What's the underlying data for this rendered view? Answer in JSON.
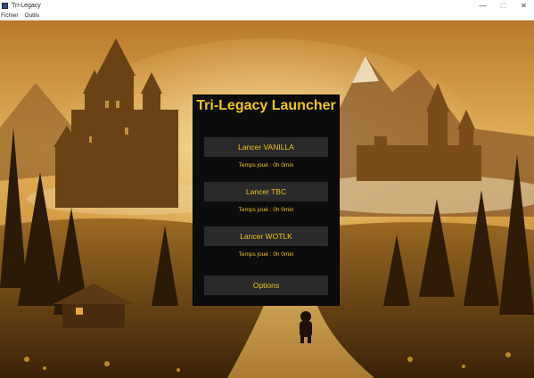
{
  "window": {
    "title": "Tri-Legacy",
    "minimize_symbol": "—",
    "maximize_symbol": "☐",
    "close_symbol": "✕"
  },
  "menu": {
    "items": [
      "Fichier",
      "Outils"
    ]
  },
  "launcher": {
    "title": "Tri-Legacy Launcher",
    "buttons": [
      {
        "label": "Lancer VANILLA",
        "playtime": "Temps joué : 0h 0min"
      },
      {
        "label": "Lancer TBC",
        "playtime": "Temps joué : 0h 0min"
      },
      {
        "label": "Lancer WOTLK",
        "playtime": "Temps joué : 0h 0min"
      }
    ],
    "options_label": "Options"
  },
  "colors": {
    "accent": "#f2c51a",
    "panel_bg": "#0c0c0c",
    "button_bg": "#2a2a2a"
  }
}
